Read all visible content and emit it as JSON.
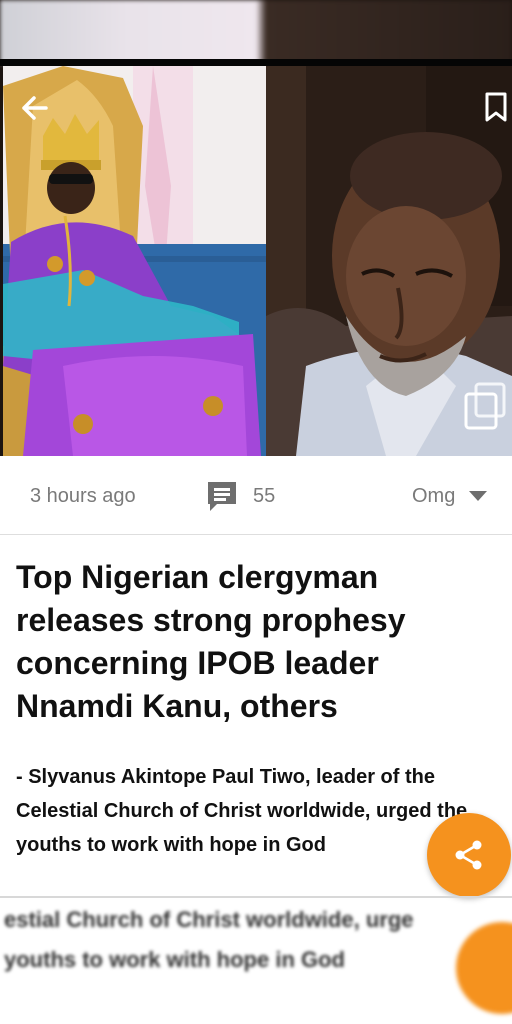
{
  "article": {
    "time": "3 hours ago",
    "comment_count": "55",
    "category": "Omg",
    "headline": "Top Nigerian clergyman releases strong prophesy concerning IPOB leader Nnamdi Kanu, others",
    "summary": "- Slyvanus Akintope Paul Tiwo, leader of the Celestial Church of Christ worldwide, urged the youths to work with hope in God"
  },
  "icons": {
    "back": "arrow-back-icon",
    "bookmark": "bookmark-icon",
    "gallery": "gallery-icon",
    "comment": "comment-icon",
    "dropdown": "chevron-down-icon",
    "share": "share-icon"
  },
  "colors": {
    "accent": "#f5921e",
    "meta_text": "#7a7a7a",
    "headline_text": "#111111"
  },
  "ghost": {
    "line1": "estial Church of Christ worldwide, urge",
    "line2": "youths to work with hope in God"
  }
}
